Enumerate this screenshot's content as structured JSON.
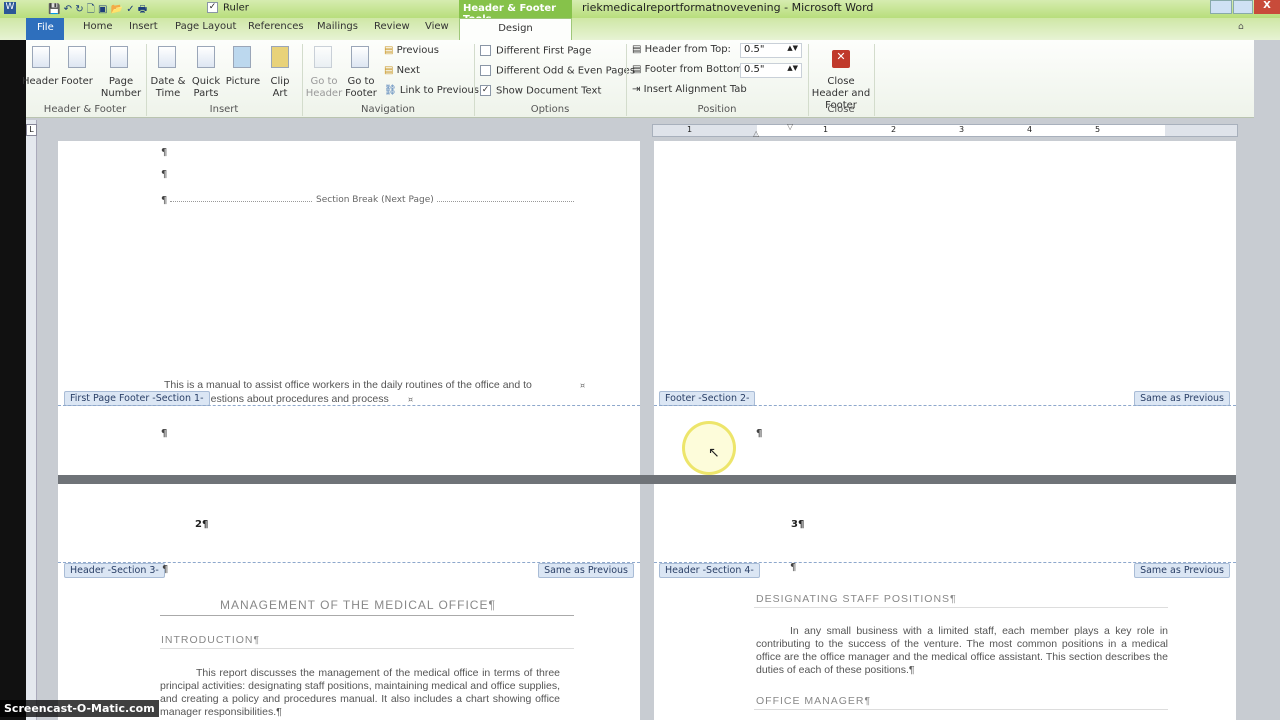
{
  "window": {
    "title": "riekmedicalreportformatnovevening  -  Microsoft Word",
    "context_tab": "Header & Footer Tools",
    "qat_ruler": "Ruler"
  },
  "tabs": [
    "File",
    "Home",
    "Insert",
    "Page Layout",
    "References",
    "Mailings",
    "Review",
    "View",
    "Design"
  ],
  "ribbon": {
    "hf_group": {
      "label": "Header & Footer",
      "buttons": [
        "Header",
        "Footer",
        "Page Number"
      ]
    },
    "insert_group": {
      "label": "Insert",
      "buttons": [
        "Date & Time",
        "Quick Parts",
        "Picture",
        "Clip Art"
      ]
    },
    "nav_group": {
      "label": "Navigation",
      "go_header": "Go to Header",
      "go_footer": "Go to Footer",
      "previous": "Previous",
      "next": "Next",
      "link": "Link to Previous"
    },
    "options_group": {
      "label": "Options",
      "diff_first": "Different First Page",
      "diff_first_checked": false,
      "diff_odd": "Different Odd & Even Pages",
      "diff_odd_checked": false,
      "show_text": "Show Document Text",
      "show_text_checked": true
    },
    "position_group": {
      "label": "Position",
      "header_top_label": "Header from Top:",
      "header_top": "0.5\"",
      "footer_bottom_label": "Footer from Bottom:",
      "footer_bottom": "0.5\"",
      "align_tab": "Insert Alignment Tab"
    },
    "close_group": {
      "label": "Close",
      "button": "Close Header and Footer"
    }
  },
  "ruler_ticks": [
    "1",
    "1",
    "2",
    "3",
    "4",
    "5"
  ],
  "doc": {
    "pilcrow": "¶",
    "section_break": "Section Break (Next Page)",
    "p1_line1": "This is a manual to assist office workers in the daily routines of the office and to",
    "p1_line2": "questions about procedures and process",
    "first_footer_tag": "First Page Footer -Section 1-",
    "footer2_tag": "Footer -Section 2-",
    "same_prev": "Same as Previous",
    "page_num_2": "2¶",
    "page_num_3": "3¶",
    "header3_tag": "Header -Section 3-",
    "header4_tag": "Header -Section 4-",
    "title": "MANAGEMENT OF THE MEDICAL OFFICE¶",
    "intro": "INTRODUCTION¶",
    "intro_text": "This report discusses the management of the medical office in terms of three principal activities: designating staff positions, maintaining medical and office supplies, and creating a policy and procedures manual. It also includes a chart showing office manager responsibilities.¶",
    "dsp": "DESIGNATING STAFF POSITIONS¶",
    "dsp_text": "In any small business with a limited staff, each member plays a key role in contributing to the success of the venture. The most common positions in a medical office are the office manager and the medical office assistant. This section describes the duties of each of these positions.¶",
    "om": "OFFICE MANAGER¶"
  },
  "watermark": "Screencast-O-Matic.com"
}
